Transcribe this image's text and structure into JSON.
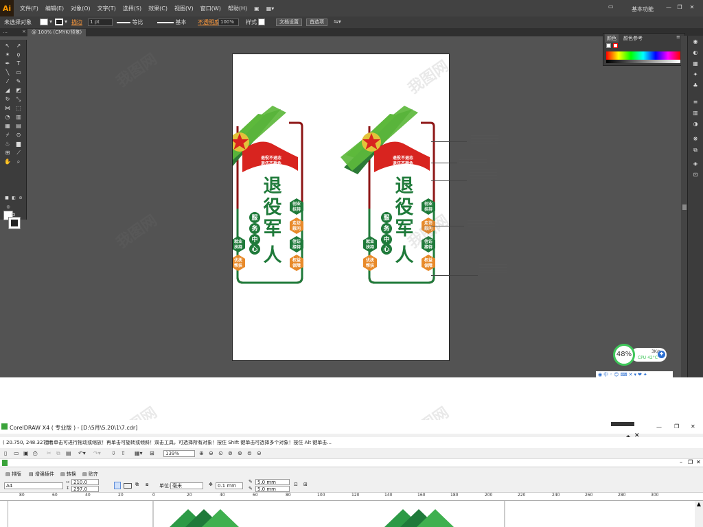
{
  "illustrator": {
    "logo": "Ai",
    "menu": [
      "文件(F)",
      "编辑(E)",
      "对象(O)",
      "文字(T)",
      "选择(S)",
      "效果(C)",
      "视图(V)",
      "窗口(W)",
      "帮助(H)"
    ],
    "workspace": "基本功能",
    "control_bar": {
      "selection": "未选择对象",
      "stroke_label": "描边",
      "stroke_weight": "1 pt",
      "profile_1": "等比",
      "profile_2": "基本",
      "opacity_label": "不透明度",
      "opacity_value": "100%",
      "style_label": "样式",
      "doc_setup": "文档设置",
      "preferences": "首选项"
    },
    "doc_tab": "@ 100% (CMYK/预览)",
    "color_panel": {
      "tab1": "颜色",
      "tab2": "颜色参考"
    },
    "signs": [
      {
        "motto": [
          "退役不退志",
          "退伍不褪色"
        ],
        "title": [
          "退",
          "役",
          "军",
          "人"
        ],
        "subtitle": [
          "服",
          "务",
          "中",
          "心"
        ],
        "hex_labels": [
          [
            "创业",
            "扶持"
          ],
          [
            "走访",
            "慰问"
          ],
          [
            "就业",
            "扶持"
          ],
          [
            "信访",
            "接待"
          ],
          [
            "优抚",
            "帮扶"
          ],
          [
            "权益",
            "保障"
          ]
        ]
      },
      {
        "motto": [
          "退役不退志",
          "退伍不褪色"
        ],
        "title": [
          "退",
          "役",
          "军",
          "人"
        ],
        "subtitle": [
          "服",
          "务",
          "中",
          "心"
        ],
        "hex_labels": [
          [
            "创业",
            "扶持"
          ],
          [
            "走访",
            "慰问"
          ],
          [
            "就业",
            "扶持"
          ],
          [
            "信访",
            "接待"
          ],
          [
            "优抚",
            "帮扶"
          ],
          [
            "权益",
            "保障"
          ]
        ]
      }
    ],
    "monitor": {
      "percent": "48%",
      "net_speed": "3K/s",
      "cpu": "CPU 42°C"
    },
    "colors": {
      "green": "#1f7a3a",
      "light_green": "#5db83c",
      "red": "#d8241f",
      "orange": "#e88a2a",
      "darkred": "#8e1616"
    }
  },
  "coreldraw": {
    "title": "CorelDRAW X4 ( 专业版 ) - [D:\\5月\\5.20\\1\\7.cdr]",
    "status": "( 20.750, 248.327 )",
    "hint": "接着单击可进行拖动或缩放！再单击可旋转或倾斜！双击工具，可选择所有对象！按住 Shift 键单击可选择多个对象！按住 Alt 键单击...",
    "zoom": "139%",
    "tabs": [
      "排版",
      "增强插件",
      "转换",
      "贴齐"
    ],
    "page_size": "A4",
    "width": "210.0 mm",
    "height": "297.0 mm",
    "unit_label": "单位:",
    "unit": "毫米",
    "nudge": "0.1 mm",
    "dup_x": "5.0 mm",
    "dup_y": "5.0 mm",
    "ruler_labels": [
      "80",
      "60",
      "40",
      "20",
      "0",
      "20",
      "40",
      "60",
      "80",
      "100",
      "120",
      "140",
      "160",
      "180",
      "200",
      "220",
      "240",
      "260",
      "280",
      "300"
    ]
  },
  "watermark": "我图网"
}
